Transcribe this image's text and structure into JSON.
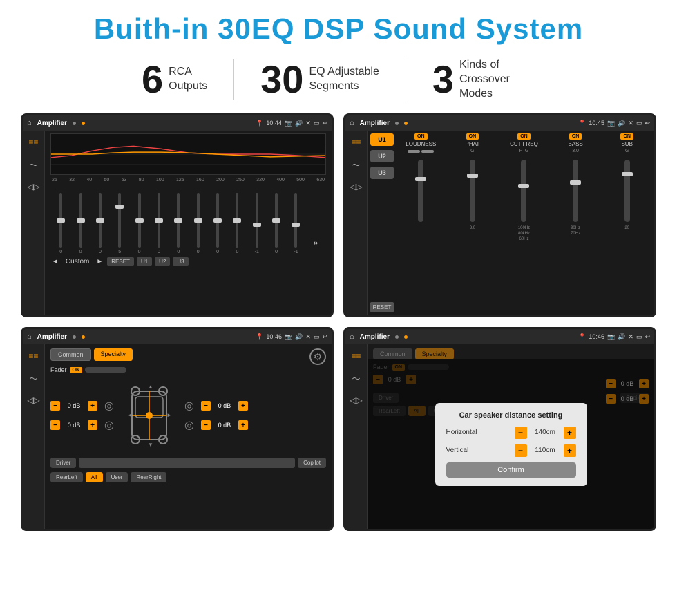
{
  "page": {
    "title": "Buith-in 30EQ DSP Sound System",
    "stats": [
      {
        "number": "6",
        "text": "RCA\nOutputs"
      },
      {
        "number": "30",
        "text": "EQ Adjustable\nSegments"
      },
      {
        "number": "3",
        "text": "Kinds of\nCrossover Modes"
      }
    ]
  },
  "screens": {
    "screen1": {
      "statusbar": {
        "title": "Amplifier",
        "time": "10:44"
      },
      "eq_freqs": [
        "25",
        "32",
        "40",
        "50",
        "63",
        "80",
        "100",
        "125",
        "160",
        "200",
        "250",
        "320",
        "400",
        "500",
        "630"
      ],
      "eq_values": [
        "0",
        "0",
        "0",
        "5",
        "0",
        "0",
        "0",
        "0",
        "0",
        "0",
        "-1",
        "0",
        "-1"
      ],
      "bottom_btns": [
        "Custom",
        "RESET",
        "U1",
        "U2",
        "U3"
      ]
    },
    "screen2": {
      "statusbar": {
        "title": "Amplifier",
        "time": "10:45"
      },
      "presets": [
        "U1",
        "U2",
        "U3"
      ],
      "columns": [
        {
          "label": "LOUDNESS",
          "on": true
        },
        {
          "label": "PHAT",
          "on": true
        },
        {
          "label": "CUT FREQ",
          "on": true
        },
        {
          "label": "BASS",
          "on": true
        },
        {
          "label": "SUB",
          "on": true
        }
      ],
      "reset_label": "RESET"
    },
    "screen3": {
      "statusbar": {
        "title": "Amplifier",
        "time": "10:46"
      },
      "tabs": [
        "Common",
        "Specialty"
      ],
      "fader_label": "Fader",
      "on_label": "ON",
      "speakers": [
        {
          "label": "0 dB"
        },
        {
          "label": "0 dB"
        },
        {
          "label": "0 dB"
        },
        {
          "label": "0 dB"
        }
      ],
      "bottom_btns": [
        "Driver",
        "",
        "Copilot",
        "RearLeft",
        "All",
        "User",
        "RearRight"
      ]
    },
    "screen4": {
      "statusbar": {
        "title": "Amplifier",
        "time": "10:46"
      },
      "tabs": [
        "Common",
        "Specialty"
      ],
      "dialog": {
        "title": "Car speaker distance setting",
        "rows": [
          {
            "label": "Horizontal",
            "value": "140cm"
          },
          {
            "label": "Vertical",
            "value": "110cm"
          }
        ],
        "confirm_label": "Confirm"
      },
      "speakers_right": [
        {
          "label": "0 dB"
        },
        {
          "label": "0 dB"
        }
      ],
      "bottom_btns": [
        "Driver",
        "",
        "Copilot",
        "RearLeft",
        "All",
        "User",
        "RearRight"
      ]
    }
  }
}
